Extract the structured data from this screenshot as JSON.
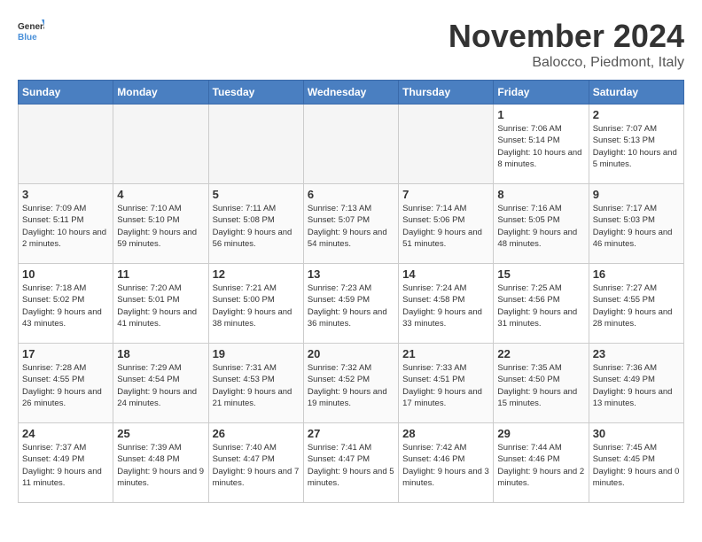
{
  "logo": {
    "general": "General",
    "blue": "Blue"
  },
  "header": {
    "title": "November 2024",
    "subtitle": "Balocco, Piedmont, Italy"
  },
  "weekdays": [
    "Sunday",
    "Monday",
    "Tuesday",
    "Wednesday",
    "Thursday",
    "Friday",
    "Saturday"
  ],
  "weeks": [
    [
      {
        "day": "",
        "info": ""
      },
      {
        "day": "",
        "info": ""
      },
      {
        "day": "",
        "info": ""
      },
      {
        "day": "",
        "info": ""
      },
      {
        "day": "",
        "info": ""
      },
      {
        "day": "1",
        "info": "Sunrise: 7:06 AM\nSunset: 5:14 PM\nDaylight: 10 hours and 8 minutes."
      },
      {
        "day": "2",
        "info": "Sunrise: 7:07 AM\nSunset: 5:13 PM\nDaylight: 10 hours and 5 minutes."
      }
    ],
    [
      {
        "day": "3",
        "info": "Sunrise: 7:09 AM\nSunset: 5:11 PM\nDaylight: 10 hours and 2 minutes."
      },
      {
        "day": "4",
        "info": "Sunrise: 7:10 AM\nSunset: 5:10 PM\nDaylight: 9 hours and 59 minutes."
      },
      {
        "day": "5",
        "info": "Sunrise: 7:11 AM\nSunset: 5:08 PM\nDaylight: 9 hours and 56 minutes."
      },
      {
        "day": "6",
        "info": "Sunrise: 7:13 AM\nSunset: 5:07 PM\nDaylight: 9 hours and 54 minutes."
      },
      {
        "day": "7",
        "info": "Sunrise: 7:14 AM\nSunset: 5:06 PM\nDaylight: 9 hours and 51 minutes."
      },
      {
        "day": "8",
        "info": "Sunrise: 7:16 AM\nSunset: 5:05 PM\nDaylight: 9 hours and 48 minutes."
      },
      {
        "day": "9",
        "info": "Sunrise: 7:17 AM\nSunset: 5:03 PM\nDaylight: 9 hours and 46 minutes."
      }
    ],
    [
      {
        "day": "10",
        "info": "Sunrise: 7:18 AM\nSunset: 5:02 PM\nDaylight: 9 hours and 43 minutes."
      },
      {
        "day": "11",
        "info": "Sunrise: 7:20 AM\nSunset: 5:01 PM\nDaylight: 9 hours and 41 minutes."
      },
      {
        "day": "12",
        "info": "Sunrise: 7:21 AM\nSunset: 5:00 PM\nDaylight: 9 hours and 38 minutes."
      },
      {
        "day": "13",
        "info": "Sunrise: 7:23 AM\nSunset: 4:59 PM\nDaylight: 9 hours and 36 minutes."
      },
      {
        "day": "14",
        "info": "Sunrise: 7:24 AM\nSunset: 4:58 PM\nDaylight: 9 hours and 33 minutes."
      },
      {
        "day": "15",
        "info": "Sunrise: 7:25 AM\nSunset: 4:56 PM\nDaylight: 9 hours and 31 minutes."
      },
      {
        "day": "16",
        "info": "Sunrise: 7:27 AM\nSunset: 4:55 PM\nDaylight: 9 hours and 28 minutes."
      }
    ],
    [
      {
        "day": "17",
        "info": "Sunrise: 7:28 AM\nSunset: 4:55 PM\nDaylight: 9 hours and 26 minutes."
      },
      {
        "day": "18",
        "info": "Sunrise: 7:29 AM\nSunset: 4:54 PM\nDaylight: 9 hours and 24 minutes."
      },
      {
        "day": "19",
        "info": "Sunrise: 7:31 AM\nSunset: 4:53 PM\nDaylight: 9 hours and 21 minutes."
      },
      {
        "day": "20",
        "info": "Sunrise: 7:32 AM\nSunset: 4:52 PM\nDaylight: 9 hours and 19 minutes."
      },
      {
        "day": "21",
        "info": "Sunrise: 7:33 AM\nSunset: 4:51 PM\nDaylight: 9 hours and 17 minutes."
      },
      {
        "day": "22",
        "info": "Sunrise: 7:35 AM\nSunset: 4:50 PM\nDaylight: 9 hours and 15 minutes."
      },
      {
        "day": "23",
        "info": "Sunrise: 7:36 AM\nSunset: 4:49 PM\nDaylight: 9 hours and 13 minutes."
      }
    ],
    [
      {
        "day": "24",
        "info": "Sunrise: 7:37 AM\nSunset: 4:49 PM\nDaylight: 9 hours and 11 minutes."
      },
      {
        "day": "25",
        "info": "Sunrise: 7:39 AM\nSunset: 4:48 PM\nDaylight: 9 hours and 9 minutes."
      },
      {
        "day": "26",
        "info": "Sunrise: 7:40 AM\nSunset: 4:47 PM\nDaylight: 9 hours and 7 minutes."
      },
      {
        "day": "27",
        "info": "Sunrise: 7:41 AM\nSunset: 4:47 PM\nDaylight: 9 hours and 5 minutes."
      },
      {
        "day": "28",
        "info": "Sunrise: 7:42 AM\nSunset: 4:46 PM\nDaylight: 9 hours and 3 minutes."
      },
      {
        "day": "29",
        "info": "Sunrise: 7:44 AM\nSunset: 4:46 PM\nDaylight: 9 hours and 2 minutes."
      },
      {
        "day": "30",
        "info": "Sunrise: 7:45 AM\nSunset: 4:45 PM\nDaylight: 9 hours and 0 minutes."
      }
    ]
  ]
}
